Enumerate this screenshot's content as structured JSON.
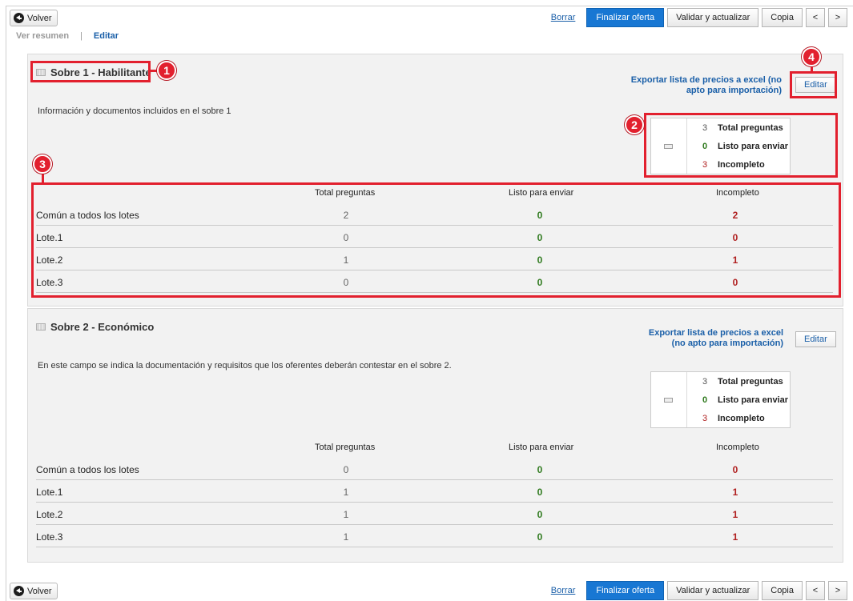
{
  "toolbar": {
    "back_label": "Volver",
    "borrar_label": "Borrar",
    "finalizar_label": "Finalizar oferta",
    "validar_label": "Validar y actualizar",
    "copia_label": "Copia",
    "prev_label": "<",
    "next_label": ">"
  },
  "view_links": {
    "resumen": "Ver resumen",
    "separator": "|",
    "editar": "Editar"
  },
  "columns": {
    "total": "Total preguntas",
    "listo": "Listo para enviar",
    "incompleto": "Incompleto"
  },
  "sections": [
    {
      "title": "Sobre 1 - Habilitante",
      "description": "Información y documentos incluidos en el sobre 1",
      "export_line1": "Exportar lista de precios a excel (no",
      "export_line2": "apto para importación)",
      "edit_label": "Editar",
      "summary": {
        "total": "3",
        "total_label": "Total preguntas",
        "listo": "0",
        "listo_label": "Listo para enviar",
        "incompleto": "3",
        "incompleto_label": "Incompleto"
      },
      "rows": [
        {
          "name": "Común a todos los lotes",
          "total": "2",
          "listo": "0",
          "incompleto": "2"
        },
        {
          "name": "Lote.1",
          "total": "0",
          "listo": "0",
          "incompleto": "0"
        },
        {
          "name": "Lote.2",
          "total": "1",
          "listo": "0",
          "incompleto": "1"
        },
        {
          "name": "Lote.3",
          "total": "0",
          "listo": "0",
          "incompleto": "0"
        }
      ]
    },
    {
      "title": "Sobre 2 - Económico",
      "description": "En este campo se indica la documentación y requisitos que los oferentes deberán contestar en el sobre 2.",
      "export_line1": "Exportar lista de precios a excel",
      "export_line2": "(no apto para importación)",
      "edit_label": "Editar",
      "summary": {
        "total": "3",
        "total_label": "Total preguntas",
        "listo": "0",
        "listo_label": "Listo para enviar",
        "incompleto": "3",
        "incompleto_label": "Incompleto"
      },
      "rows": [
        {
          "name": "Común a todos los lotes",
          "total": "0",
          "listo": "0",
          "incompleto": "0"
        },
        {
          "name": "Lote.1",
          "total": "1",
          "listo": "0",
          "incompleto": "1"
        },
        {
          "name": "Lote.2",
          "total": "1",
          "listo": "0",
          "incompleto": "1"
        },
        {
          "name": "Lote.3",
          "total": "1",
          "listo": "0",
          "incompleto": "1"
        }
      ]
    }
  ],
  "callouts": [
    "1",
    "2",
    "3",
    "4"
  ],
  "colors": {
    "primary": "#1877d3",
    "link": "#1a5fa8",
    "callout": "#e2202e",
    "ready": "#2f7a1e",
    "incomplete": "#b02020"
  }
}
